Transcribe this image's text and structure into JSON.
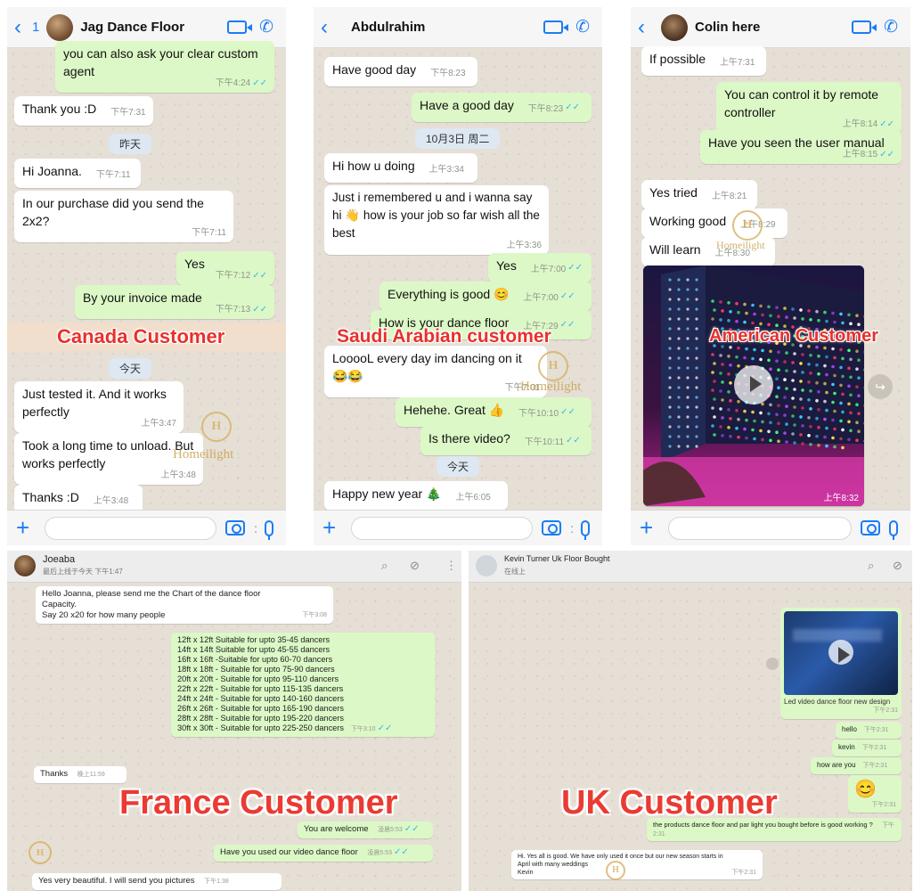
{
  "panel1": {
    "back_count": "1",
    "contact": "Jag Dance Floor",
    "label": "Canada Customer",
    "messages": [
      {
        "text": "you can also ask your clear custom agent",
        "time": "下午4:24"
      },
      {
        "text": "Thank you :D",
        "time": "下午7:31"
      },
      {
        "text": "昨天"
      },
      {
        "text": "Hi Joanna.",
        "time": "下午7:11"
      },
      {
        "text": "In our purchase did you send the 2x2?",
        "time": "下午7:11"
      },
      {
        "text": "Yes",
        "time": "下午7:12"
      },
      {
        "text": "By your invoice made",
        "time": "下午7:13"
      },
      {
        "text": "今天"
      },
      {
        "text": "Just tested it. And it works perfectly",
        "time": "上午3:47"
      },
      {
        "text": "Took a long time to unload. But works perfectly",
        "time": "上午3:48"
      },
      {
        "text": "Thanks :D",
        "time": "上午3:48"
      }
    ]
  },
  "panel2": {
    "contact": "Abdulrahim",
    "label": "Saudi Arabian customer",
    "messages": [
      {
        "text": "Have good day",
        "time": "下午8:23"
      },
      {
        "text": "Have a good day",
        "time": "下午8:23"
      },
      {
        "text": "10月3日 周二"
      },
      {
        "text": "Hi how u doing",
        "time": "上午3:34"
      },
      {
        "text": "Just i remembered u and i wanna say hi 👋 how is your job so far wish all the best",
        "time": "上午3:36"
      },
      {
        "text": "Yes",
        "time": "上午7:00"
      },
      {
        "text": "Everything is good 😊",
        "time": "上午7:00"
      },
      {
        "text": "How is your dance floor",
        "time": "上午7:29"
      },
      {
        "text": "LooooL every day im dancing on it 😂😂",
        "time": "下午7:01"
      },
      {
        "text": "Hehehe.  Great 👍",
        "time": "下午10:10"
      },
      {
        "text": "Is there video?",
        "time": "下午10:11"
      },
      {
        "text": "今天"
      },
      {
        "text": "Happy new year 🎄",
        "time": "上午6:05"
      }
    ]
  },
  "panel3": {
    "contact": "Colin here",
    "label": "American Customer",
    "messages": [
      {
        "text": "If possible",
        "time": "上午7:31"
      },
      {
        "text": "You can control it by remote controller",
        "time": "上午8:14"
      },
      {
        "text": "Have you seen the user manual",
        "time": "上午8:15"
      },
      {
        "text": "Yes tried",
        "time": "上午8:21"
      },
      {
        "text": "Working good",
        "time": "上午8:29"
      },
      {
        "text": "Will learn",
        "time": "上午8:30"
      },
      {
        "text": "",
        "time": "上午8:32"
      }
    ]
  },
  "panel4": {
    "contact": "Joeaba",
    "status": "最后上线于今天 下午1:47",
    "label": "France Customer",
    "msg1": [
      "Hello Joanna, please send me the Chart of the dance floor",
      "Capacity.",
      "Say 20 x20 for how many people"
    ],
    "msg1_time": "下午3:08",
    "sizes": [
      "12ft x 12ft Suitable for upto 35-45 dancers",
      "14ft x 14ft Suitable for upto 45-55 dancers",
      "16ft x 16ft -Suitable for upto 60-70 dancers",
      "18ft x 18ft - Suitable for upto 75-90 dancers",
      "20ft x 20ft - Suitable for upto 95-110 dancers",
      "22ft x 22ft - Suitable for upto 115-135 dancers",
      "24ft x 24ft - Suitable for upto 140-160 dancers",
      "26ft x 26ft - Suitable for upto 165-190 dancers",
      "28ft x 28ft - Suitable for upto 195-220 dancers",
      "30ft x 30ft - Suitable for upto 225-250 dancers"
    ],
    "sizes_time": "下午3:10",
    "thanks": "Thanks",
    "thanks_time": "晚上11:59",
    "welcome": "You are welcome",
    "welcome_time": "凌晨5:53",
    "used": "Have you used our video dance floor",
    "used_time": "凌晨5:53",
    "reply": "Yes very beautiful. I will send you pictures",
    "reply_time": "下午1:38"
  },
  "panel5": {
    "contact": "Kevin Turner Uk Floor Bought",
    "status": "在线上",
    "label": "UK Customer",
    "video_caption": "Led video dance floor new design",
    "video_time": "下午2:31",
    "hello": "hello",
    "hello_time": "下午2:31",
    "kevin": "kevin",
    "kevin_time": "下午2:31",
    "how": "how are you",
    "how_time": "下午2:31",
    "emoji": "😊",
    "emoji_time": "下午2:31",
    "products": "the products dance floor and par light you bought before is good working ?",
    "products_time": "下午2:31",
    "reply": [
      "Hi. Yes all is good. We have only used it once but our new season starts in",
      "April with many weddings",
      "Kevin"
    ],
    "reply_time": "下午2:31"
  },
  "watermark": "Homeilight",
  "watermark_logo": "H",
  "colors": {
    "out_bubble": "#dcf8c6",
    "in_bubble": "#ffffff",
    "ios_blue": "#1a7cf5",
    "label_red": "#e8312c"
  }
}
